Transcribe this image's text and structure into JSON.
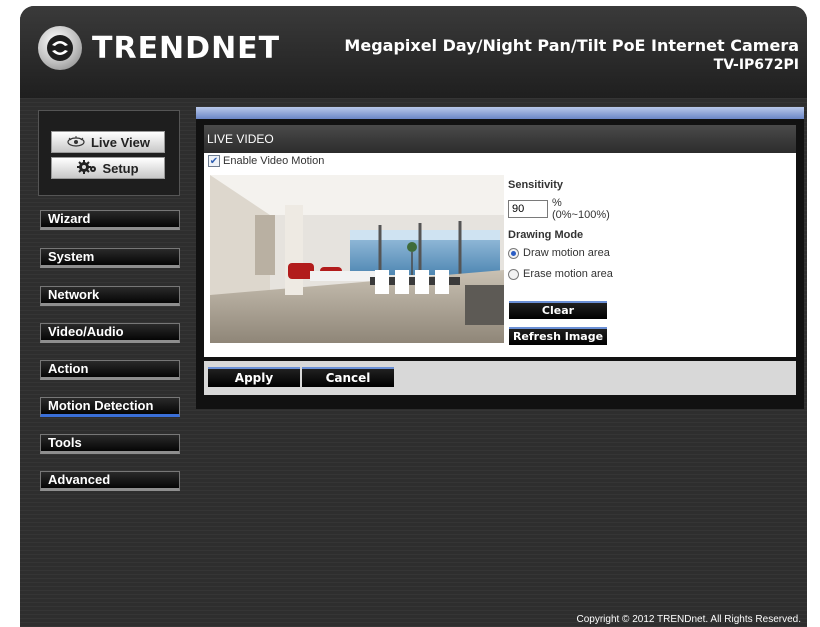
{
  "header": {
    "brand": "TRENDNET",
    "product_name": "Megapixel Day/Night Pan/Tilt PoE Internet Camera",
    "model": "TV-IP672PI"
  },
  "mode_buttons": {
    "live_view": "Live View",
    "setup": "Setup"
  },
  "nav": {
    "items": [
      {
        "label": "Wizard"
      },
      {
        "label": "System"
      },
      {
        "label": "Network"
      },
      {
        "label": "Video/Audio"
      },
      {
        "label": "Action"
      },
      {
        "label": "Motion Detection"
      },
      {
        "label": "Tools"
      },
      {
        "label": "Advanced"
      }
    ],
    "active": "Motion Detection"
  },
  "section": {
    "title": "LIVE VIDEO"
  },
  "motion": {
    "enable_label": "Enable Video Motion",
    "enable_checked": true,
    "sensitivity_label": "Sensitivity",
    "sensitivity_value": "90",
    "sensitivity_range": "%(0%~100%)",
    "drawing_mode_label": "Drawing Mode",
    "draw_label": "Draw motion area",
    "erase_label": "Erase motion area",
    "selected_mode": "draw",
    "clear_label": "Clear",
    "refresh_label": "Refresh Image"
  },
  "footer": {
    "apply_label": "Apply",
    "cancel_label": "Cancel",
    "copyright": "Copyright © 2012 TRENDnet. All Rights Reserved."
  },
  "colors": {
    "accent": "#3a6fd8",
    "panel_bg": "#2e2e2e"
  }
}
